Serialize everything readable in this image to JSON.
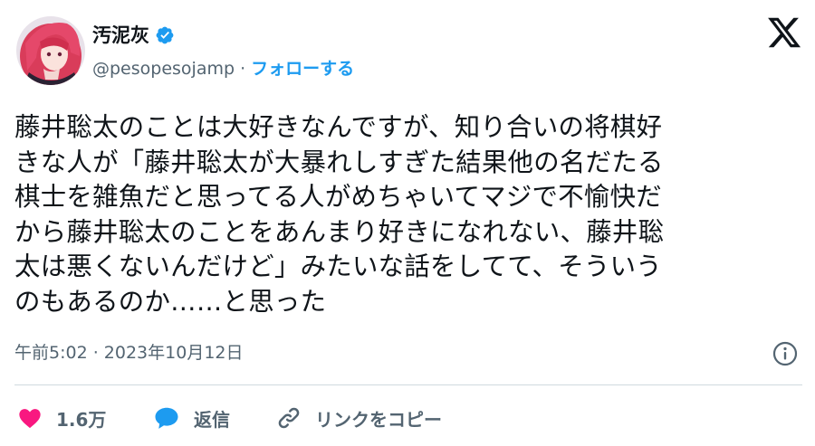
{
  "author": {
    "display_name": "汚泥灰",
    "handle": "@pesopesojamp",
    "separator": " · ",
    "follow_label": "フォローする"
  },
  "tweet": {
    "lines": [
      "藤井聡太のことは大好きなんですが、知り合いの将棋好",
      "きな人が「藤井聡太が大暴れしすぎた結果他の名だたる",
      "棋士を雑魚だと思ってる人がめちゃいてマジで不愉快だ",
      "から藤井聡太のことをあんまり好きになれない、藤井聡",
      "太は悪くないんだけど」みたいな話をしてて、そういう",
      "のもあるのか……と思った"
    ],
    "timestamp": "午前5:02 · 2023年10月12日"
  },
  "actions": {
    "like_count": "1.6万",
    "reply_label": "返信",
    "copy_link_label": "リンクをコピー"
  },
  "icons": {
    "verified": "verified-badge-icon",
    "x_logo": "x-logo-icon",
    "info": "info-icon",
    "heart": "heart-icon",
    "reply": "speech-bubble-icon",
    "link": "link-icon"
  },
  "colors": {
    "text": "#0f1419",
    "secondary": "#536471",
    "accent": "#1d9bf0",
    "like": "#f91880",
    "divider": "#cfd9de"
  }
}
